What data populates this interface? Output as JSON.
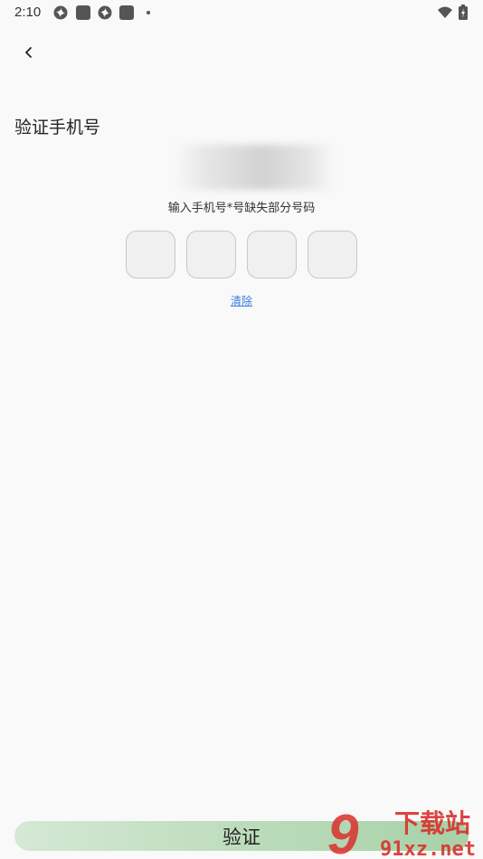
{
  "status_bar": {
    "time": "2:10",
    "icons": [
      "pinwheel-icon",
      "square-icon",
      "pinwheel-icon",
      "square-icon",
      "dot-icon",
      "wifi-icon",
      "battery-icon"
    ]
  },
  "header": {
    "back_icon": "chevron-left-icon"
  },
  "main": {
    "title": "验证手机号",
    "hint": "输入手机号*号缺失部分号码",
    "code_count": 4,
    "clear_label": "清除"
  },
  "footer": {
    "verify_label": "验证"
  },
  "watermark": {
    "text_top": "下载站",
    "text_bottom": "91xz.net",
    "logo": "9"
  },
  "colors": {
    "background": "#f9f9f9",
    "link": "#3b7de0",
    "button_gradient_start": "#d5e8d5",
    "button_gradient_end": "#a8d1a8",
    "watermark_red": "#d9312b"
  }
}
